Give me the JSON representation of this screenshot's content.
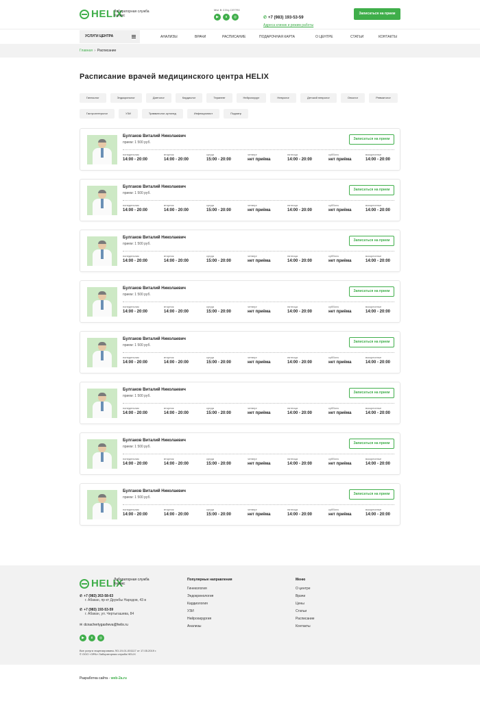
{
  "header": {
    "logo_text": "HELIX",
    "logo_subtitle": "Лабораторная служба Хеликс",
    "social_caption": "МЫ В СОЦ.СЕТЯХ",
    "social_icons": [
      "youtube-icon",
      "vk-icon",
      "instagram-icon"
    ],
    "phone": "+7 (983) 193-53-59",
    "address_link": "Адреса клиник и режим работы",
    "cta_label": "Записаться на прием",
    "accent_color": "#3fae4a"
  },
  "nav": {
    "services_label": "УСЛУГИ ЦЕНТРА",
    "links": [
      "АНАЛИЗЫ",
      "ВРАЧИ",
      "РАСПИСАНИЕ",
      "ПОДАРОЧНАЯ КАРТА",
      "О ЦЕНТРЕ",
      "СТАТЬИ",
      "КОНТАКТЫ"
    ]
  },
  "breadcrumb": {
    "home": "Главная",
    "separator": "»",
    "current": "Расписание"
  },
  "main": {
    "title": "Расписание врачей медицинского центра HELIX",
    "tags": [
      "Гинеколог",
      "Эндокринолог",
      "Диетолог",
      "Кардиолог",
      "Терапевт",
      "Нейрохирург",
      "Невролог",
      "Детский невролог",
      "Онколог",
      "Ревматолог",
      "Гастроэнтеролог",
      "УЗИ",
      "Травматолог-ортопед",
      "Инфекционист",
      "Подиатр"
    ],
    "day_labels": [
      "понедельник",
      "вторник",
      "среда",
      "четверг",
      "пятница",
      "суббота",
      "воскресенье"
    ],
    "doctors": [
      {
        "name": "Булгаков Виталий Николаевич",
        "price": "прием: 1 500 руб.",
        "button": "Записаться на прием",
        "schedule": [
          "14:00 - 20:00",
          "14:00 - 20:00",
          "15:00 - 20:00",
          "нет приёма",
          "14:00 - 20:00",
          "нет приёма",
          "14:00 - 20:00"
        ]
      },
      {
        "name": "Булгаков Виталий Николаевич",
        "price": "прием: 1 500 руб.",
        "button": "Записаться на прием",
        "schedule": [
          "14:00 - 20:00",
          "14:00 - 20:00",
          "15:00 - 20:00",
          "нет приёма",
          "14:00 - 20:00",
          "нет приёма",
          "14:00 - 20:00"
        ]
      },
      {
        "name": "Булгаков Виталий Николаевич",
        "price": "прием: 1 500 руб.",
        "button": "Записаться на прием",
        "schedule": [
          "14:00 - 20:00",
          "14:00 - 20:00",
          "15:00 - 20:00",
          "нет приёма",
          "14:00 - 20:00",
          "нет приёма",
          "14:00 - 20:00"
        ]
      },
      {
        "name": "Булгаков Виталий Николаевич",
        "price": "прием: 1 500 руб.",
        "button": "Записаться на прием",
        "schedule": [
          "14:00 - 20:00",
          "14:00 - 20:00",
          "15:00 - 20:00",
          "нет приёма",
          "14:00 - 20:00",
          "нет приёма",
          "14:00 - 20:00"
        ]
      },
      {
        "name": "Булгаков Виталий Николаевич",
        "price": "прием: 1 500 руб.",
        "button": "Записаться на прием",
        "schedule": [
          "14:00 - 20:00",
          "14:00 - 20:00",
          "15:00 - 20:00",
          "нет приёма",
          "14:00 - 20:00",
          "нет приёма",
          "14:00 - 20:00"
        ]
      },
      {
        "name": "Булгаков Виталий Николаевич",
        "price": "прием: 1 500 руб.",
        "button": "Записаться на прием",
        "schedule": [
          "14:00 - 20:00",
          "14:00 - 20:00",
          "15:00 - 20:00",
          "нет приёма",
          "14:00 - 20:00",
          "нет приёма",
          "14:00 - 20:00"
        ]
      },
      {
        "name": "Булгаков Виталий Николаевич",
        "price": "прием: 1 500 руб.",
        "button": "Записаться на прием",
        "schedule": [
          "14:00 - 20:00",
          "14:00 - 20:00",
          "15:00 - 20:00",
          "нет приёма",
          "14:00 - 20:00",
          "нет приёма",
          "14:00 - 20:00"
        ]
      },
      {
        "name": "Булгаков Виталий Николаевич",
        "price": "прием: 1 500 руб.",
        "button": "Записаться на прием",
        "schedule": [
          "14:00 - 20:00",
          "14:00 - 20:00",
          "15:00 - 20:00",
          "нет приёма",
          "14:00 - 20:00",
          "нет приёма",
          "14:00 - 20:00"
        ]
      }
    ]
  },
  "footer": {
    "logo_text": "HELIX",
    "logo_subtitle": "Лабораторная служба Хеликс",
    "contacts": [
      {
        "phone": "+7 (983) 263-58-63",
        "address": "г. Абакан, пр-кт Дружбы Народов, 43 в"
      },
      {
        "phone": "+7 (983) 193-53-59",
        "address": "г. Абакан, ул. Чертыгашева, 84"
      }
    ],
    "email": "dcnachertygasheva@helix.ru",
    "license": "Все услуги лицензированы ЛО-19-01-001117 от 17.05.2019 г.",
    "copyright": "© ООО «ЭРА» Лабораторная служба HELIX",
    "popular": {
      "title": "Популярные направления",
      "items": [
        "Гинекология",
        "Эндокринология",
        "Кардиология",
        "УЗИ",
        "Нейрохирургия",
        "Анализы"
      ]
    },
    "menu": {
      "title": "Меню",
      "items": [
        "О центре",
        "Врачи",
        "Цены",
        "Статьи",
        "Расписание",
        "Контакты"
      ]
    }
  },
  "developer": {
    "text": "Разработка сайта - ",
    "link": "web-2a.ru"
  }
}
